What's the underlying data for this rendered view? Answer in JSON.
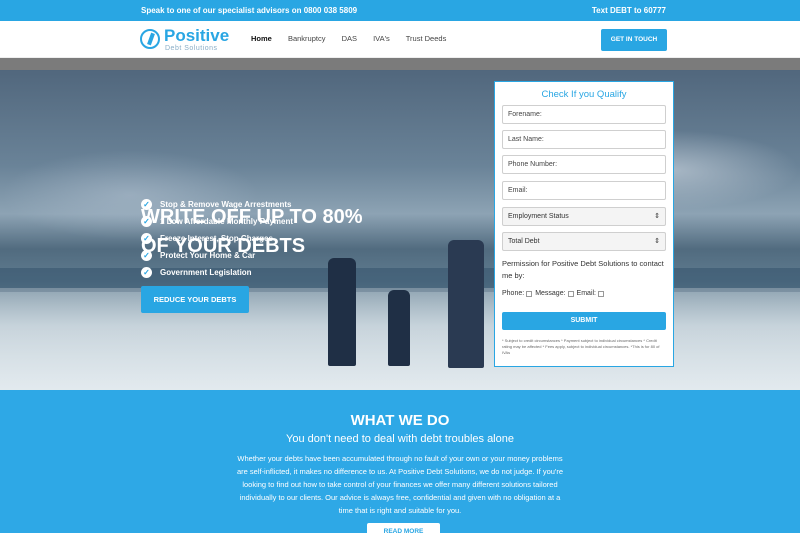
{
  "topbar": {
    "advisor_text": "Speak to one of our specialist advisors on 0800 038 5809",
    "text_line": "Text DEBT to 60777"
  },
  "brand": {
    "logo_name": "Positive",
    "logo_sub": "Debt Solutions",
    "logo_icon": "pds-logo-icon",
    "accent": "#29a6e3"
  },
  "nav": {
    "items": [
      {
        "label": "Home",
        "active": true
      },
      {
        "label": "Bankruptcy",
        "active": false
      },
      {
        "label": "DAS",
        "active": false
      },
      {
        "label": "IVA's",
        "active": false
      },
      {
        "label": "Trust Deeds",
        "active": false
      }
    ],
    "cta": "GET IN TOUCH"
  },
  "hero": {
    "title_line1": "WRITE OFF UP TO 80%",
    "title_line2": "OF YOUR DEBTS",
    "benefits": [
      "Stop & Remove Wage Arrestments",
      "1 Low Affordable Monthly Payment",
      "Freeze Interest, Stop Charges",
      "Protect Your Home & Car",
      "Government Legislation"
    ],
    "button": "REDUCE YOUR DEBTS"
  },
  "form": {
    "title": "Check If you Qualify",
    "placeholders": {
      "forename": "Forename:",
      "last_name": "Last Name:",
      "phone": "Phone Number:",
      "email": "Email:"
    },
    "employment_status": "Employment Status",
    "total_debt": "Total Debt",
    "permission": "Permission for Positive Debt Solutions to contact me by:",
    "contact_phone": "Phone:",
    "contact_message": "Message:",
    "contact_email": "Email:",
    "submit": "SUBMIT",
    "fine_print": "* Subject to credit circumstances * Payment subject to individual circumstances * Credit rating may be affected * Fees apply, subject to individual circumstances. *This is for 80 of IVAs"
  },
  "what_we_do": {
    "heading": "WHAT WE DO",
    "subheading": "You don't need to deal with debt troubles alone",
    "body": "Whether your debts have been accumulated through no fault of your own or your money problems are self-inflicted, it makes no difference to us. At Positive Debt Solutions, we do not judge. If you're looking to find out how to take control of your finances we offer many different solutions tailored individually to our clients. Our advice is always free, confidential and given with no obligation at a time that is right and suitable for you.",
    "button": "READ MORE"
  }
}
